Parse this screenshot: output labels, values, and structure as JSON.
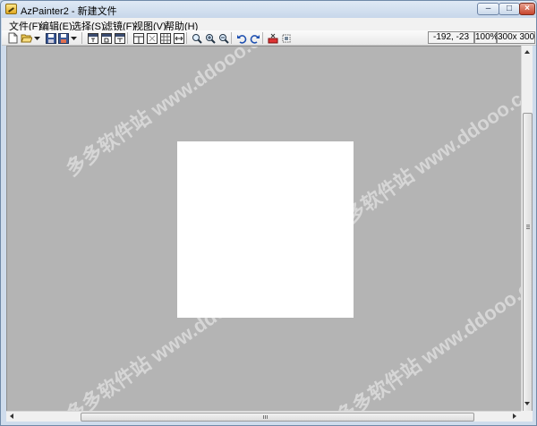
{
  "window": {
    "title": "AzPainter2 - 新建文件",
    "minimize_label": "–",
    "maximize_label": "□",
    "close_label": "×"
  },
  "menu": {
    "items": [
      {
        "label": "文件(F)"
      },
      {
        "label": "编辑(E)"
      },
      {
        "label": "选择(S)"
      },
      {
        "label": "滤镜(F)"
      },
      {
        "label": "视图(V)"
      },
      {
        "label": "帮助(H)"
      }
    ]
  },
  "toolbar": {
    "icons": [
      "new-file-icon",
      "open-folder-icon",
      "dropdown-arrow-icon",
      "save-icon",
      "save-as-icon",
      "dropdown-arrow-icon",
      "window-panel-icon",
      "window-panel-icon",
      "window-panel-icon",
      "layout-icon",
      "grid-icon",
      "grid-icon",
      "fit-width-icon",
      "zoom-icon",
      "zoom-in-icon",
      "zoom-out-icon",
      "undo-icon",
      "redo-icon",
      "palette-icon",
      "brush-icon"
    ]
  },
  "status": {
    "coords": "-192, -23",
    "zoom": "100%",
    "size": "300x 300"
  },
  "watermark": {
    "text": "多多软件站 www.ddooo.com"
  },
  "colors": {
    "canvas_bg": "#b4b4b4",
    "paper": "#ffffff",
    "titlebar": "#cfdcec"
  }
}
